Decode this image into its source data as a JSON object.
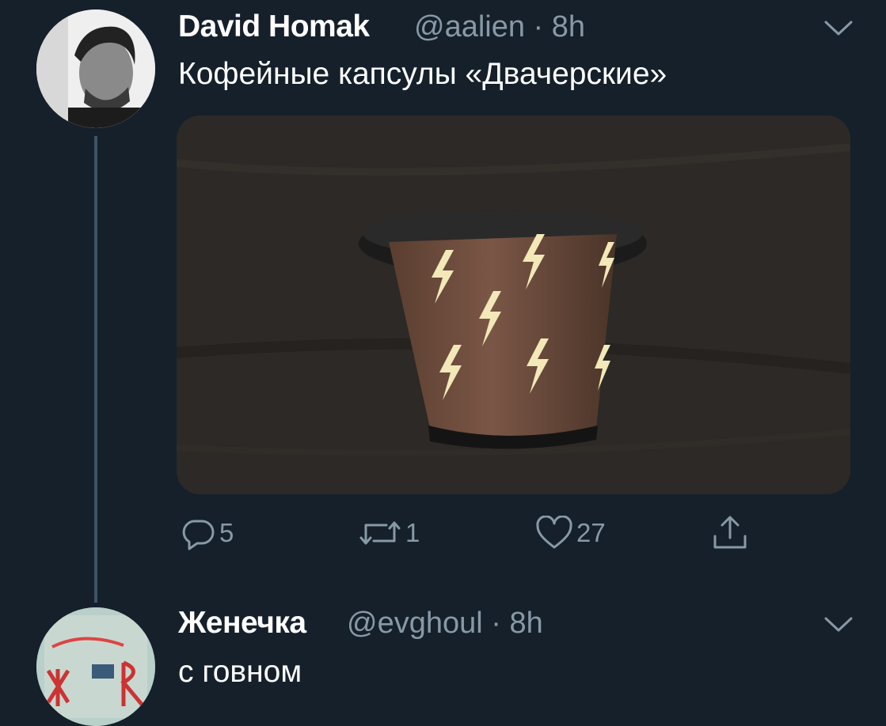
{
  "tweets": [
    {
      "author_name": "David Homak",
      "handle_time": "@aalien · 8h",
      "text": "Кофейные капсулы «Двачерские»",
      "actions": {
        "replies": "5",
        "retweets": "1",
        "likes": "27"
      }
    },
    {
      "author_name": "Женечка",
      "handle_time": "@evghoul · 8h",
      "text": "с говном"
    }
  ],
  "colors": {
    "background": "#15202b",
    "secondary_text": "#8899a6",
    "thread_line": "#3d5466"
  },
  "icons": [
    "chevron-down-icon",
    "reply-icon",
    "retweet-icon",
    "like-icon",
    "share-icon"
  ]
}
